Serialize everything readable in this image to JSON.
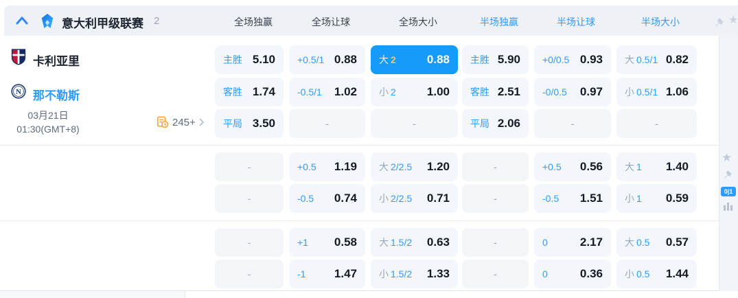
{
  "ui": {
    "dash": "-"
  },
  "colors": {
    "accent": "#2e9bff",
    "selected_bg": "#169bfa",
    "selected_handicap_text": "#f0c75a",
    "markets_icon_orange": "#ff9e2d"
  },
  "header": {
    "league": "意大利甲级联赛",
    "count": "2",
    "cols": [
      "全场独赢",
      "全场让球",
      "全场大小",
      "半场独赢",
      "半场让球",
      "半场大小"
    ]
  },
  "match": {
    "home": "卡利亚里",
    "away": "那不勒斯",
    "date": "03月21日",
    "time": "01:30(GMT+8)",
    "markets": "245+"
  },
  "sidebar": {
    "badge": "0|1"
  },
  "odds": {
    "rows": [
      [
        {
          "t": "win",
          "l": "主胜",
          "v": "5.10"
        },
        {
          "t": "hcap",
          "l": "+0.5/1",
          "v": "0.88"
        },
        {
          "t": "ou",
          "g": "大",
          "h": "2",
          "v": "0.88",
          "sel": true
        },
        {
          "t": "win",
          "l": "主胜",
          "v": "5.90"
        },
        {
          "t": "hcap",
          "l": "+0/0.5",
          "v": "0.93"
        },
        {
          "t": "ou",
          "g": "大",
          "h": "0.5/1",
          "v": "0.82"
        }
      ],
      [
        {
          "t": "win",
          "l": "客胜",
          "v": "1.74"
        },
        {
          "t": "hcap",
          "l": "-0.5/1",
          "v": "1.02"
        },
        {
          "t": "ou",
          "g": "小",
          "h": "2",
          "v": "1.00"
        },
        {
          "t": "win",
          "l": "客胜",
          "v": "2.51"
        },
        {
          "t": "hcap",
          "l": "-0/0.5",
          "v": "0.97"
        },
        {
          "t": "ou",
          "g": "小",
          "h": "0.5/1",
          "v": "1.06"
        }
      ],
      [
        {
          "t": "win",
          "l": "平局",
          "v": "3.50"
        },
        {
          "t": "empty"
        },
        {
          "t": "empty"
        },
        {
          "t": "win",
          "l": "平局",
          "v": "2.06"
        },
        {
          "t": "empty"
        },
        {
          "t": "empty"
        }
      ],
      [
        {
          "t": "empty"
        },
        {
          "t": "hcap",
          "l": "+0.5",
          "v": "1.19"
        },
        {
          "t": "ou",
          "g": "大",
          "h": "2/2.5",
          "v": "1.20"
        },
        {
          "t": "empty"
        },
        {
          "t": "hcap",
          "l": "+0.5",
          "v": "0.56"
        },
        {
          "t": "ou",
          "g": "大",
          "h": "1",
          "v": "1.40"
        }
      ],
      [
        {
          "t": "empty"
        },
        {
          "t": "hcap",
          "l": "-0.5",
          "v": "0.74"
        },
        {
          "t": "ou",
          "g": "小",
          "h": "2/2.5",
          "v": "0.71"
        },
        {
          "t": "empty"
        },
        {
          "t": "hcap",
          "l": "-0.5",
          "v": "1.51"
        },
        {
          "t": "ou",
          "g": "小",
          "h": "1",
          "v": "0.59"
        }
      ],
      [
        {
          "t": "empty"
        },
        {
          "t": "hcap",
          "l": "+1",
          "v": "0.58"
        },
        {
          "t": "ou",
          "g": "大",
          "h": "1.5/2",
          "v": "0.63"
        },
        {
          "t": "empty"
        },
        {
          "t": "hcap",
          "l": "0",
          "v": "2.17"
        },
        {
          "t": "ou",
          "g": "大",
          "h": "0.5",
          "v": "0.57"
        }
      ],
      [
        {
          "t": "empty"
        },
        {
          "t": "hcap",
          "l": "-1",
          "v": "1.47"
        },
        {
          "t": "ou",
          "g": "小",
          "h": "1.5/2",
          "v": "1.33"
        },
        {
          "t": "empty"
        },
        {
          "t": "hcap",
          "l": "0",
          "v": "0.36"
        },
        {
          "t": "ou",
          "g": "小",
          "h": "0.5",
          "v": "1.44"
        }
      ]
    ]
  }
}
